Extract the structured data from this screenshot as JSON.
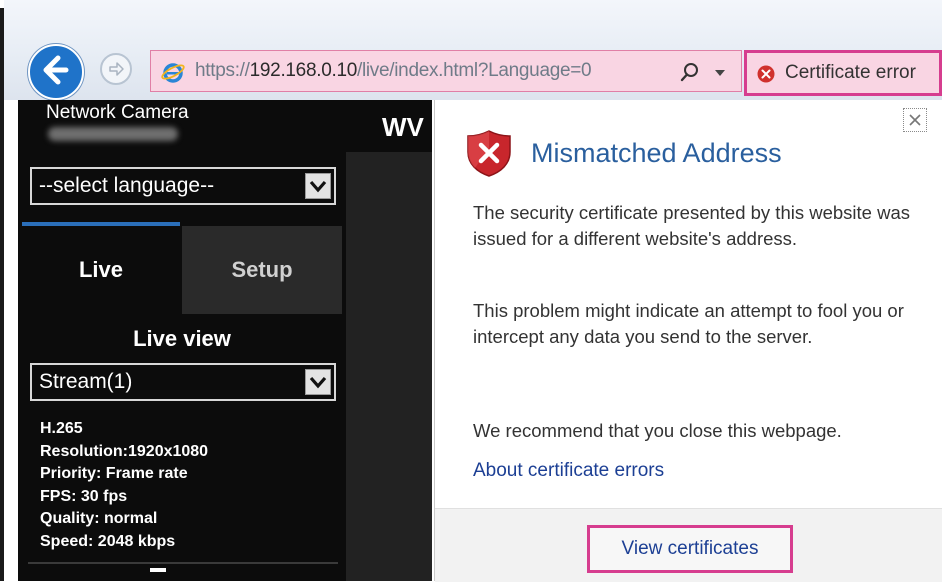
{
  "browser": {
    "url_prefix": "https://",
    "url_host": "192.168.0.10",
    "url_path": "/live/index.html?Language=0",
    "cert_error_label": "Certificate error"
  },
  "camera": {
    "title": "Network Camera",
    "header_title": "WV",
    "language_select": "--select language--",
    "tabs": [
      {
        "label": "Live",
        "active": true
      },
      {
        "label": "Setup",
        "active": false
      }
    ],
    "live_view_heading": "Live view",
    "stream_select": "Stream(1)",
    "stream_info": [
      "H.265",
      "Resolution:1920x1080",
      "Priority: Frame rate",
      "FPS: 30 fps",
      "Quality: normal",
      "Speed:  2048 kbps"
    ]
  },
  "cert_popup": {
    "title": "Mismatched Address",
    "paragraph_1": "The security certificate presented by this website was issued for a different website's address.",
    "paragraph_2": "This problem might indicate an attempt to fool you or intercept any data you send to the server.",
    "paragraph_3": "We recommend that you close this webpage.",
    "about_link": "About certificate errors",
    "view_certificates_button": "View certificates"
  },
  "colors": {
    "highlight": "#d63d8f",
    "address_bar_bg": "#f9d5e3",
    "link": "#1c3f94",
    "popup_title": "#2a5f9e",
    "back_button": "#1f73c9",
    "sidebar_bg": "#0c0c0c"
  },
  "icons": {
    "back": "back-arrow-icon",
    "forward": "forward-arrow-icon",
    "ie": "internet-explorer-icon",
    "search": "search-icon",
    "dropdown": "chevron-down-icon",
    "cert_error": "error-x-icon",
    "shield": "shield-x-icon",
    "close": "close-icon"
  }
}
